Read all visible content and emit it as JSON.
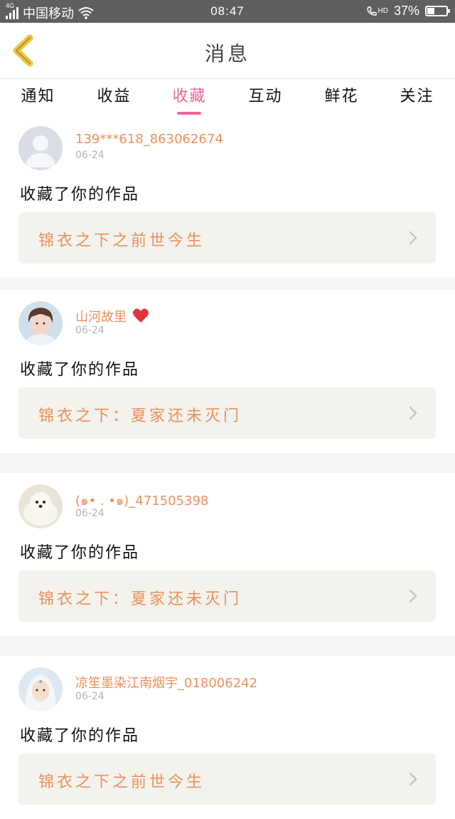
{
  "status_bar": {
    "network": "4G",
    "carrier": "中国移动",
    "time": "08:47",
    "call_label": "HD",
    "battery": "37%",
    "battery_level": 0.37
  },
  "header": {
    "title": "消息"
  },
  "tabs": [
    {
      "label": "通知"
    },
    {
      "label": "收益"
    },
    {
      "label": "收藏"
    },
    {
      "label": "互动"
    },
    {
      "label": "鲜花"
    },
    {
      "label": "关注"
    }
  ],
  "active_tab": "收藏",
  "notifications": [
    {
      "username": "139***618_863062674",
      "date": "06-24",
      "action": "收藏了你的作品",
      "work": "锦衣之下之前世今生",
      "avatar": "default-person-avatar"
    },
    {
      "username": "山河故里",
      "date": "06-24",
      "action": "收藏了你的作品",
      "work": "锦衣之下：夏家还未灭门",
      "avatar": "young-man-photo-avatar"
    },
    {
      "username": "(๑• . •๑)_471505398",
      "date": "06-24",
      "action": "收藏了你的作品",
      "work": "锦衣之下：夏家还未灭门",
      "avatar": "white-puppy-photo-avatar"
    },
    {
      "username": "凉笙墨染江南烟宇_018006242",
      "date": "06-24",
      "action": "收藏了你的作品",
      "work": "锦衣之下之前世今生",
      "avatar": "white-haired-figure-avatar"
    }
  ],
  "colors": {
    "accent_pink": "#e8669a",
    "username_orange": "#ee8f5c",
    "back_arrow_yellow": "#f0c43a",
    "heart_red": "#e0353b"
  }
}
